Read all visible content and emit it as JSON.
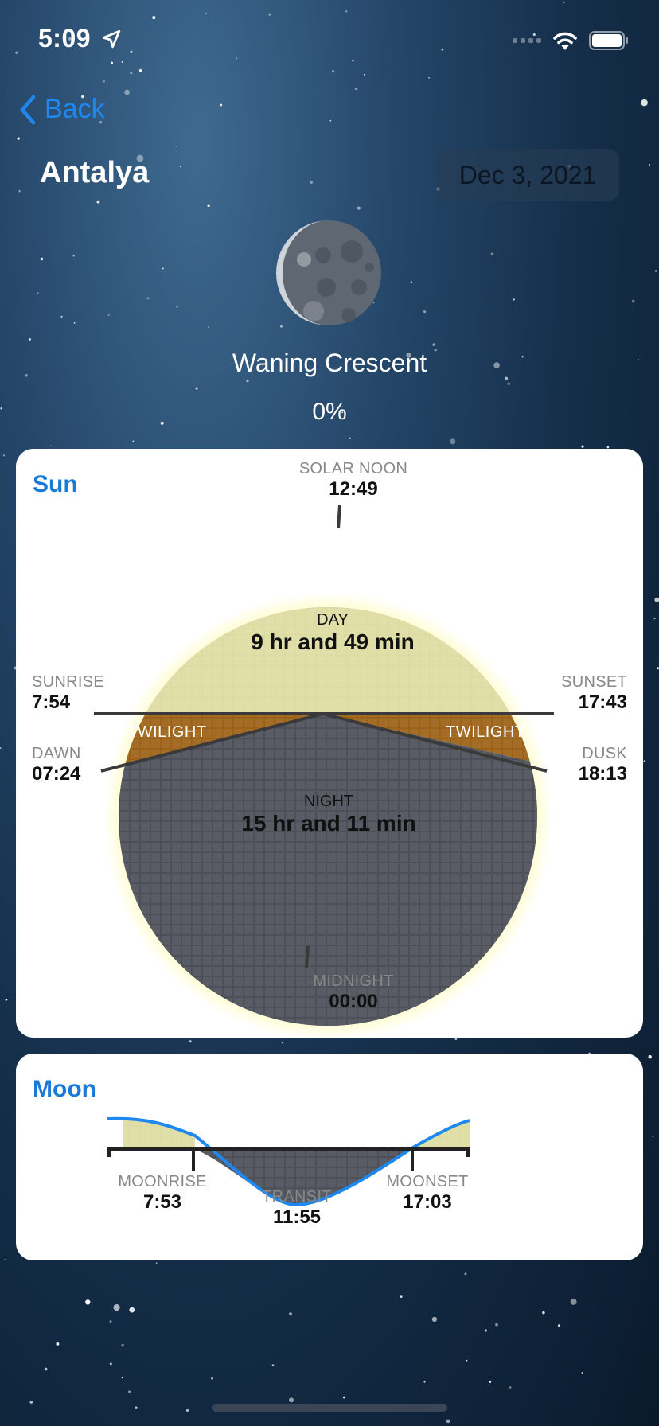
{
  "status_bar": {
    "time": "5:09"
  },
  "nav": {
    "back_label": "Back",
    "city": "Antalya",
    "date": "Dec 3, 2021"
  },
  "moon_phase": {
    "name": "Waning Crescent",
    "illumination": "0%"
  },
  "sun_card": {
    "title": "Sun",
    "solar_noon": {
      "label": "SOLAR NOON",
      "time": "12:49"
    },
    "sunrise": {
      "label": "SUNRISE",
      "time": "7:54"
    },
    "sunset": {
      "label": "SUNSET",
      "time": "17:43"
    },
    "dawn": {
      "label": "DAWN",
      "time": "07:24"
    },
    "dusk": {
      "label": "DUSK",
      "time": "18:13"
    },
    "day": {
      "label": "DAY",
      "duration": "9 hr and 49 min"
    },
    "night": {
      "label": "NIGHT",
      "duration": "15 hr and 11 min"
    },
    "twilight_label": "TWILIGHT",
    "midnight": {
      "label": "MIDNIGHT",
      "time": "00:00"
    }
  },
  "moon_card": {
    "title": "Moon",
    "moonrise": {
      "label": "MOONRISE",
      "time": "7:53"
    },
    "transit": {
      "label": "TRANSIT",
      "time": "11:55"
    },
    "moonset": {
      "label": "MOONSET",
      "time": "17:03"
    }
  },
  "colors": {
    "accent": "#1a7ad8",
    "day": "#dedba3",
    "twilight": "#9c6218",
    "night": "#4c5059",
    "moon_curve": "#1e88f0"
  },
  "icons": [
    "location-arrow-icon",
    "signal-icon",
    "wifi-icon",
    "battery-icon",
    "chevron-left-icon",
    "moon-phase-icon"
  ]
}
